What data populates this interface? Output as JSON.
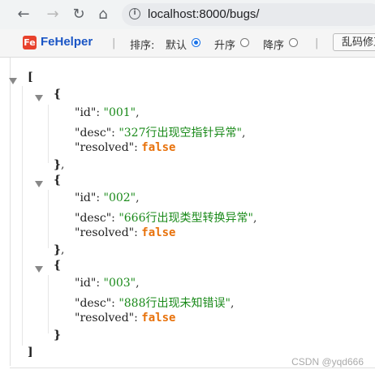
{
  "browser": {
    "back_icon": "arrow-left-icon",
    "forward_icon": "arrow-right-icon",
    "reload_icon": "reload-icon",
    "home_icon": "home-icon",
    "info_icon": "info-icon",
    "url": "localhost:8000/bugs/"
  },
  "toolbar": {
    "brand": "FeHelper",
    "sort_label": "排序:",
    "options": [
      {
        "label": "默认",
        "checked": true
      },
      {
        "label": "升序",
        "checked": false
      },
      {
        "label": "降序",
        "checked": false
      }
    ],
    "button_label": "乱码修正"
  },
  "json": {
    "open_bracket": "[",
    "close_bracket": "]",
    "items": [
      {
        "id": "\"001\"",
        "desc": "\"327行出现空指针异常\"",
        "resolved": "false"
      },
      {
        "id": "\"002\"",
        "desc": "\"666行出现类型转换异常\"",
        "resolved": "false"
      },
      {
        "id": "\"003\"",
        "desc": "\"888行出现未知错误\"",
        "resolved": "false"
      }
    ],
    "keys": {
      "id": "\"id\"",
      "desc": "\"desc\"",
      "resolved": "\"resolved\""
    }
  },
  "watermark": "CSDN @yqd666",
  "colors": {
    "string": "#1a8a1a",
    "boolean": "#e8720c",
    "brand": "#1a55c5"
  }
}
